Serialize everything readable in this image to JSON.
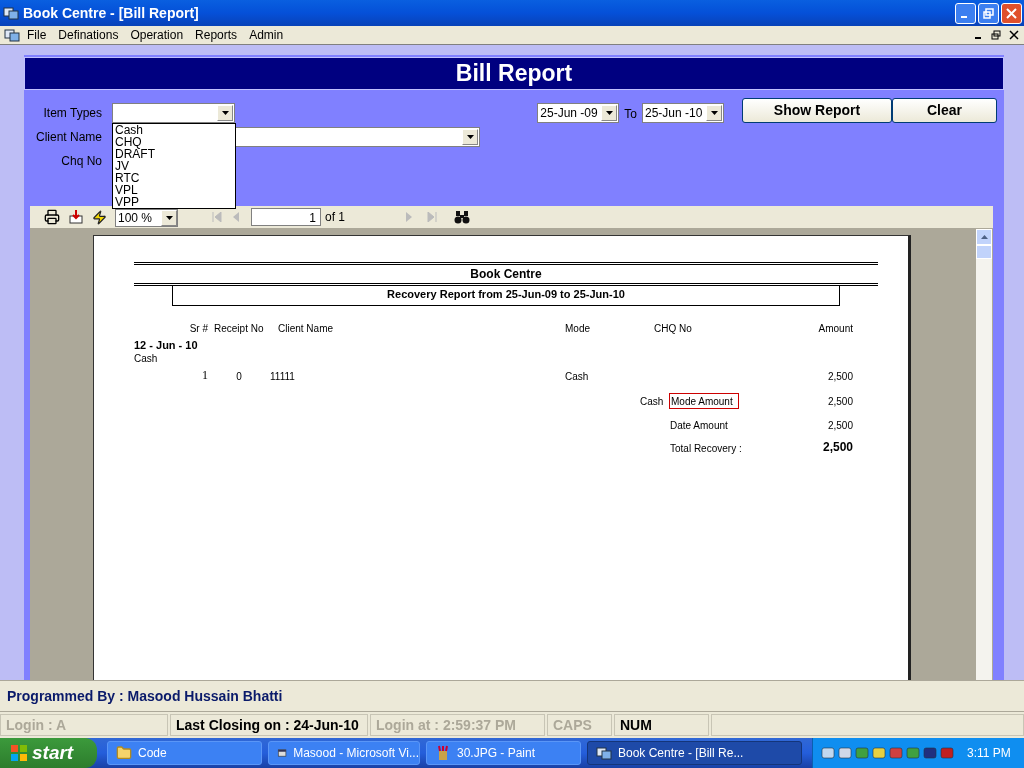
{
  "window": {
    "title": "Book Centre  - [Bill Report]"
  },
  "menu": [
    "File",
    "Definations",
    "Operation",
    "Reports",
    "Admin"
  ],
  "form": {
    "heading": "Bill Report",
    "item_types": {
      "label": "Item Types",
      "expanded": true,
      "options": [
        {
          "label": "Cash",
          "selected": false
        },
        {
          "label": "CHQ",
          "selected": false
        },
        {
          "label": "DRAFT",
          "selected": false
        },
        {
          "label": "JV",
          "selected": false
        },
        {
          "label": "RTC",
          "selected": false
        },
        {
          "label": "VPL",
          "selected": false
        },
        {
          "label": "VPP",
          "selected": false
        }
      ]
    },
    "client_name": {
      "label": "Client Name"
    },
    "chq_no": {
      "label": "Chq No"
    },
    "date_from": "25-Jun -09",
    "to_label": "To",
    "date_to": "25-Jun -10",
    "buttons": [
      "Show Report",
      "Clear"
    ]
  },
  "viewer": {
    "zoom": "100 %",
    "page": "1",
    "page_of": "of 1"
  },
  "report": {
    "title": "Book Centre",
    "subtitle": "Recovery Report from 25-Jun-09 to 25-Jun-10",
    "columns": [
      "Sr #",
      "Receipt No",
      "Client Name",
      "Mode",
      "CHQ No",
      "Amount"
    ],
    "group": {
      "date": "12 - Jun - 10",
      "mode": "Cash",
      "rows": [
        {
          "sr": "1",
          "receipt": "0",
          "client": "11111",
          "mode": "Cash",
          "amount": "2,500"
        }
      ]
    },
    "summary": [
      {
        "kind": "mode",
        "prefix": "Cash",
        "label": "Mode Amount",
        "amount": "2,500"
      },
      {
        "kind": "date",
        "label": "Date Amount",
        "amount": "2,500"
      },
      {
        "kind": "total",
        "label": "Total Recovery :",
        "amount": "2,500"
      }
    ]
  },
  "footer": "Programmed By : Masood Hussain Bhatti",
  "status_bar": [
    {
      "text": "Login :  A",
      "disabled": true
    },
    {
      "text": "Last Closing on : 24-Jun-10",
      "disabled": false
    },
    {
      "text": "Login at : 2:59:37 PM",
      "disabled": true
    },
    {
      "text": "CAPS",
      "disabled": true
    },
    {
      "text": "NUM",
      "disabled": false
    }
  ],
  "taskbar": {
    "start": "start",
    "tasks": [
      {
        "label": "Code",
        "kind": "folder",
        "selected": false
      },
      {
        "label": "Masood - Microsoft Vi...",
        "kind": "studio",
        "selected": false
      },
      {
        "label": "30.JPG - Paint",
        "kind": "paint",
        "selected": false
      },
      {
        "label": "Book Centre  - [Bill Re...",
        "kind": "app",
        "selected": true
      }
    ],
    "clock": "3:11 PM"
  }
}
